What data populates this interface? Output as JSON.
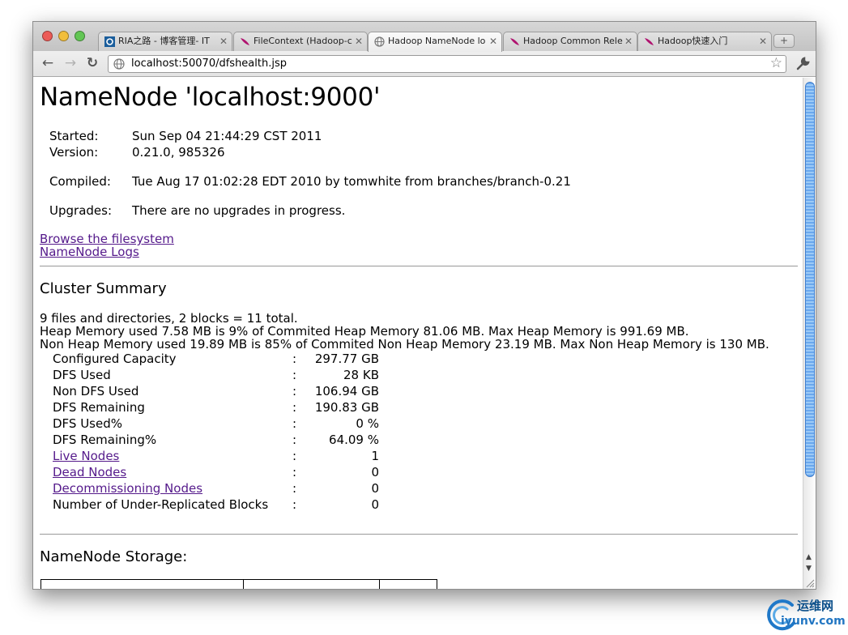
{
  "browser": {
    "tabs": [
      {
        "label": "RIA之路 - 博客管理- IT",
        "icon": "ria-favicon"
      },
      {
        "label": "FileContext (Hadoop-c",
        "icon": "feather-favicon"
      },
      {
        "label": "Hadoop NameNode lo",
        "icon": "globe-favicon",
        "active": true
      },
      {
        "label": "Hadoop Common Rele",
        "icon": "feather-favicon"
      },
      {
        "label": "Hadoop快速入门",
        "icon": "feather-favicon"
      }
    ],
    "close_glyph": "✕",
    "new_tab_glyph": "+",
    "address": "localhost:50070/dfshealth.jsp",
    "back_glyph": "←",
    "forward_glyph": "→",
    "reload_glyph": "↻",
    "star_glyph": "☆"
  },
  "page": {
    "title": "NameNode 'localhost:9000'",
    "info": [
      {
        "label": "Started:",
        "value": "Sun Sep 04 21:44:29 CST 2011"
      },
      {
        "label": "Version:",
        "value": "0.21.0, 985326"
      },
      {
        "label": "Compiled:",
        "value": "Tue Aug 17 01:02:28 EDT 2010 by tomwhite from branches/branch-0.21"
      },
      {
        "label": "Upgrades:",
        "value": "There are no upgrades in progress."
      }
    ],
    "links": {
      "browse": "Browse the filesystem",
      "logs": "NameNode Logs"
    },
    "cluster_summary": {
      "heading": "Cluster Summary",
      "lines": [
        "9 files and directories, 2 blocks = 11 total.",
        "Heap Memory used 7.58 MB is 9% of Commited Heap Memory 81.06 MB. Max Heap Memory is 991.69 MB.",
        "Non Heap Memory used 19.89 MB is 85% of Commited Non Heap Memory 23.19 MB. Max Non Heap Memory is 130 MB."
      ],
      "separator": ":",
      "stats": [
        {
          "label": "Configured Capacity",
          "value": "297.77 GB",
          "link": false
        },
        {
          "label": "DFS Used",
          "value": "28 KB",
          "link": false
        },
        {
          "label": "Non DFS Used",
          "value": "106.94 GB",
          "link": false
        },
        {
          "label": "DFS Remaining",
          "value": "190.83 GB",
          "link": false
        },
        {
          "label": "DFS Used%",
          "value": "0 %",
          "link": false
        },
        {
          "label": "DFS Remaining%",
          "value": "64.09 %",
          "link": false
        },
        {
          "label": "Live Nodes",
          "value": "1",
          "link": true
        },
        {
          "label": "Dead Nodes",
          "value": "0",
          "link": true
        },
        {
          "label": "Decommissioning Nodes",
          "value": "0",
          "link": true
        },
        {
          "label": "Number of Under-Replicated Blocks",
          "value": "0",
          "link": false
        }
      ]
    },
    "storage_heading": "NameNode Storage:"
  },
  "watermark": {
    "top": "运维网",
    "bottom": "iyunv.com"
  },
  "colors": {
    "link": "#551a8b",
    "scroll_thumb": "#6aa8ee"
  }
}
